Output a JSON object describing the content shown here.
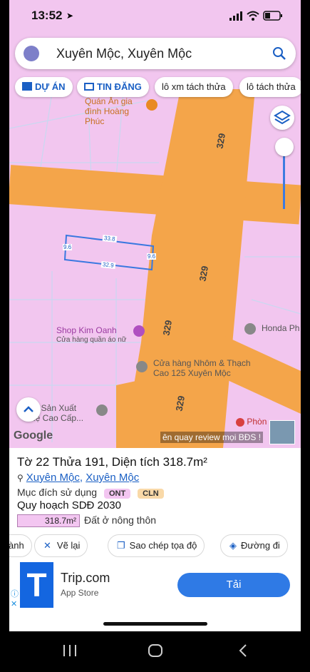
{
  "status": {
    "time": "13:52"
  },
  "search": {
    "query": "Xuyên Mộc, Xuyên Mộc"
  },
  "chips": [
    {
      "label": "DỰ ÁN"
    },
    {
      "label": "TIN ĐĂNG"
    },
    {
      "label": "lô xm tách thửa"
    },
    {
      "label": "lô tách thửa"
    }
  ],
  "map": {
    "pois": {
      "restaurant": "Quán Ăn gia đình Hoàng Phúc",
      "shop_name": "Shop Kim Oanh",
      "shop_sub": "Cửa hàng quần áo nữ",
      "aluminum": "Cửa hàng Nhôm & Thạch Cao 125 Xuyên Mộc",
      "honda": "Honda Ph",
      "factory_1": "ng Sản Xuất",
      "factory_2": "Hệ Cao Cấp...",
      "room": "Phòn"
    },
    "road_label": "329",
    "parcel": {
      "top": "33.8",
      "bottom": "32.9",
      "left": "9.6",
      "right": "9.6"
    },
    "google_logo": "Google",
    "overlay_text": "ên quay review mọi BĐS !"
  },
  "info": {
    "title": "Tờ 22 Thửa 191, Diện tích 318.7m²",
    "addr_1": "Xuyên Mộc",
    "addr_sep": ", ",
    "addr_2": "Xuyên Mộc",
    "usage_label": "Mục đích sử dụng",
    "tags": [
      "ONT",
      "CLN"
    ],
    "plan": "Quy hoạch SDĐ 2030",
    "plan_area": "318.7m²",
    "plan_desc": "Đất ở nông thôn"
  },
  "actions": [
    {
      "label": "ành"
    },
    {
      "label": "Vẽ lại"
    },
    {
      "label": "Sao chép tọa độ"
    },
    {
      "label": "Đường đi"
    }
  ],
  "ad": {
    "logo_letter": "T",
    "app_name": "Trip.com",
    "store": "App Store",
    "cta": "Tải"
  },
  "colors": {
    "land": "#f2c6ef",
    "road": "#f4a54a",
    "accent": "#1a5fc4",
    "install": "#2f7ae5"
  }
}
